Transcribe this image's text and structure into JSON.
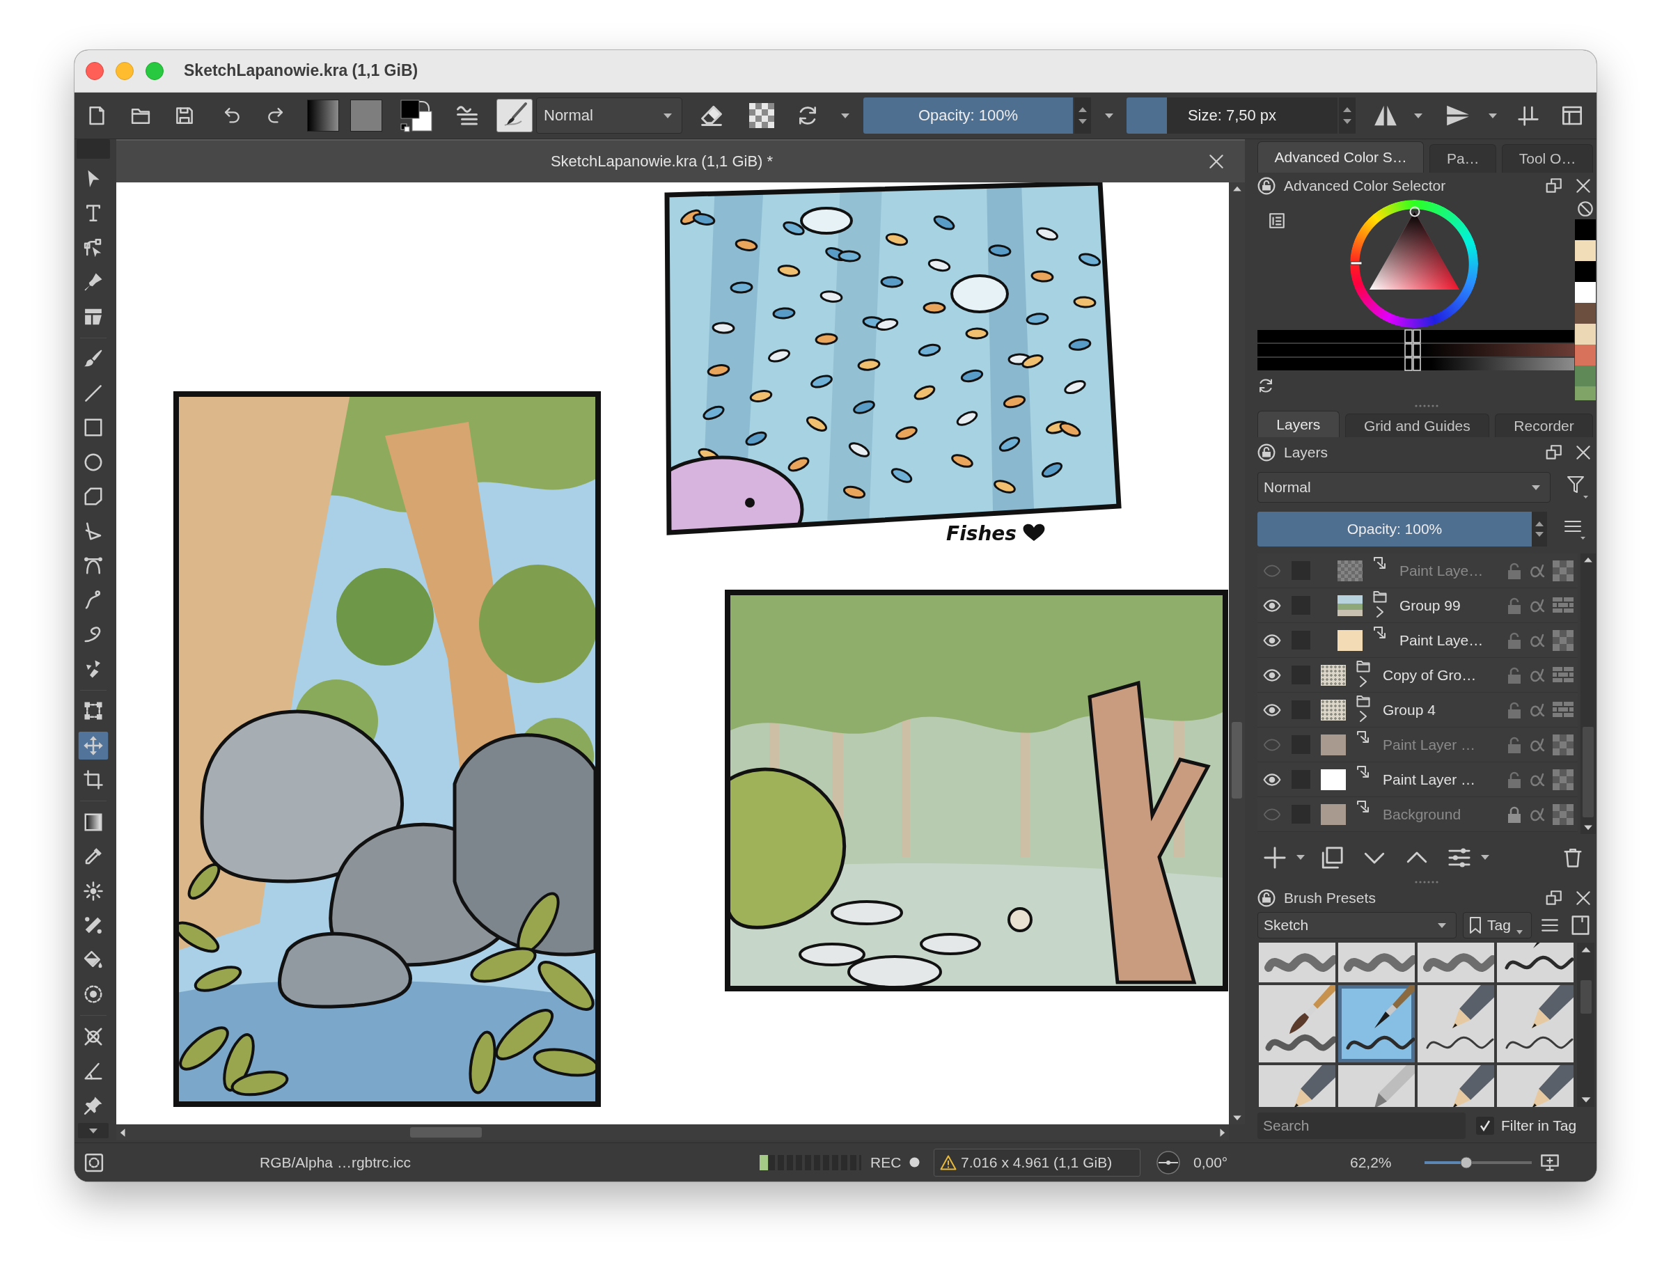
{
  "window": {
    "title": "SketchLapanowie.kra (1,1 GiB)"
  },
  "toolbar": {
    "blend_mode": "Normal",
    "opacity": {
      "label": "Opacity: 100%",
      "level": 1
    },
    "size": {
      "label": "Size: 7,50 px",
      "level": 0.19
    }
  },
  "toolbox": {
    "groups": [
      {
        "tools": [
          {
            "kind": "pointer",
            "selected": false
          },
          {
            "kind": "text",
            "selected": false
          },
          {
            "kind": "nodes",
            "selected": false
          },
          {
            "kind": "calligraphy",
            "selected": false
          },
          {
            "kind": "panel",
            "selected": false
          }
        ]
      },
      {
        "tools": [
          {
            "kind": "brush",
            "selected": false
          },
          {
            "kind": "line",
            "selected": false
          },
          {
            "kind": "rectangle",
            "selected": false
          },
          {
            "kind": "ellipse",
            "selected": false
          },
          {
            "kind": "polygon",
            "selected": false
          },
          {
            "kind": "polyline",
            "selected": false
          },
          {
            "kind": "bezier",
            "selected": false
          },
          {
            "kind": "freehand",
            "selected": false
          },
          {
            "kind": "dynamic",
            "selected": false
          },
          {
            "kind": "multibrush",
            "selected": false
          }
        ]
      },
      {
        "tools": [
          {
            "kind": "transform",
            "selected": false
          },
          {
            "kind": "move",
            "selected": true
          },
          {
            "kind": "crop",
            "selected": false
          }
        ]
      },
      {
        "tools": [
          {
            "kind": "gradient",
            "selected": false
          },
          {
            "kind": "picker",
            "selected": false
          },
          {
            "kind": "patch",
            "selected": false
          },
          {
            "kind": "colorize",
            "selected": false
          },
          {
            "kind": "fill",
            "selected": false
          },
          {
            "kind": "enclose",
            "selected": false
          }
        ]
      },
      {
        "tools": [
          {
            "kind": "assistant",
            "selected": false
          },
          {
            "kind": "measure",
            "selected": false
          },
          {
            "kind": "pin",
            "selected": false
          }
        ]
      }
    ]
  },
  "document": {
    "tab_title": "SketchLapanowie.kra (1,1 GiB) *",
    "caption": "Fishes"
  },
  "dock": {
    "color_tabs": [
      {
        "label": "Advanced Color S…",
        "selected": true
      },
      {
        "label": "Pa…",
        "selected": false
      },
      {
        "label": "Tool O…",
        "selected": false
      }
    ],
    "color_selector": {
      "title": "Advanced Color Selector",
      "sliders": [
        {
          "level": 0.49
        },
        {
          "level": 0.49
        },
        {
          "level": 0.49
        }
      ],
      "recent_colors": [
        {
          "color": "#000000"
        },
        {
          "color": "#f2ddb9"
        },
        {
          "color": "#000000"
        },
        {
          "color": "#ffffff"
        },
        {
          "color": "#6d4f40"
        },
        {
          "color": "#ecd8b5"
        },
        {
          "color": "#d8725b"
        },
        {
          "color": "#5f8a57"
        },
        {
          "color": "#80a468"
        }
      ]
    },
    "layer_tabs": [
      {
        "label": "Layers",
        "selected": true
      },
      {
        "label": "Grid and Guides",
        "selected": false
      },
      {
        "label": "Recorder",
        "selected": false
      }
    ],
    "layers": {
      "title": "Layers",
      "blend_mode": "Normal",
      "opacity": {
        "label": "Opacity: 100%",
        "level": 1
      },
      "items": [
        {
          "children": [
            {
              "name": "Paint Laye…",
              "kind": "paint",
              "visible": false,
              "locked": false,
              "thumbnail": {
                "kind": "checker"
              }
            },
            {
              "name": "Group 99",
              "kind": "group",
              "expanded": false,
              "visible": true,
              "locked": false,
              "thumbnail": {
                "kind": "scene"
              }
            },
            {
              "name": "Paint Laye…",
              "kind": "paint",
              "visible": true,
              "locked": false,
              "thumbnail": {
                "kind": "solid",
                "color": "#f3dcb5"
              }
            }
          ]
        },
        {
          "name": "Copy of Gro…",
          "kind": "group",
          "expanded": false,
          "visible": true,
          "locked": false,
          "thumbnail": {
            "kind": "sketch"
          }
        },
        {
          "name": "Group 4",
          "kind": "group",
          "expanded": false,
          "visible": true,
          "locked": false,
          "thumbnail": {
            "kind": "sketch"
          }
        },
        {
          "name": "Paint Layer …",
          "kind": "paint",
          "visible": false,
          "locked": false,
          "thumbnail": {
            "kind": "solid",
            "color": "#a89a8e"
          }
        },
        {
          "name": "Paint Layer …",
          "kind": "paint",
          "visible": true,
          "locked": false,
          "thumbnail": {
            "kind": "solid",
            "color": "#ffffff"
          }
        },
        {
          "name": "Background",
          "kind": "paint",
          "visible": false,
          "locked": true,
          "thumbnail": {
            "kind": "solid",
            "color": "#a89a8e"
          }
        }
      ]
    },
    "brush_presets": {
      "title": "Brush Presets",
      "tag": "Sketch",
      "tag_button": "Tag",
      "presets": [
        {
          "kind": "marker",
          "selected": false
        },
        {
          "kind": "marker",
          "selected": false
        },
        {
          "kind": "marker",
          "selected": false
        },
        {
          "kind": "inkpen",
          "selected": false
        },
        {
          "kind": "brush",
          "selected": false
        },
        {
          "kind": "inkpen",
          "selected": true
        },
        {
          "kind": "pencil",
          "selected": false
        },
        {
          "kind": "pencil",
          "selected": false
        },
        {
          "kind": "pencil",
          "selected": false
        },
        {
          "kind": "pen",
          "selected": false
        },
        {
          "kind": "pencil",
          "selected": false
        },
        {
          "kind": "pencil",
          "selected": false
        }
      ],
      "search": {
        "placeholder": "Search"
      },
      "filter_in_tag": {
        "label": "Filter in Tag",
        "checked": true
      }
    }
  },
  "status_bar": {
    "color_profile": "RGB/Alpha …rgbtrc.icc",
    "memory": {
      "level": 0.08
    },
    "recording": {
      "label": "REC",
      "active": false
    },
    "image_size": "7.016 x 4.961 (1,1 GiB)",
    "rotation": "0,00°",
    "zoom": {
      "label": "62,2%",
      "level": 0.39
    }
  }
}
